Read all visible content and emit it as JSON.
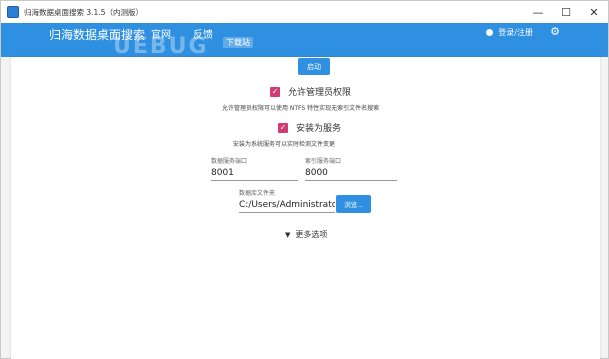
{
  "window": {
    "title": "归海数据桌面搜索 3.1.5（内测版）",
    "controls": {
      "minimize": "—",
      "maximize": "☐",
      "close": "✕"
    }
  },
  "header": {
    "brand": "归海数据桌面搜索",
    "nav": {
      "site": "官网",
      "feedback": "反馈"
    },
    "watermark": "UEBUG",
    "watermark_tag": "下载站",
    "login": "登录/注册",
    "colors": {
      "primary": "#2f8fe0",
      "accent": "#d23c73"
    }
  },
  "main": {
    "start_button": "启动",
    "admin": {
      "label": "允许管理员权限",
      "checked": true,
      "description": "允许管理员权限可以使用 NTFS 特性实现无索引文件名搜索"
    },
    "service": {
      "label": "安装为服务",
      "checked": true,
      "description": "安装为系统服务可以实时检测文件变更"
    },
    "db_port": {
      "label": "数据服务端口",
      "value": "8001"
    },
    "index_port": {
      "label": "索引服务端口",
      "value": "8000"
    },
    "db_folder": {
      "label": "数据库文件夹",
      "value": "C:/Users/Administrator/G"
    },
    "browse_button": "浏览...",
    "more_options": "更多选项"
  }
}
